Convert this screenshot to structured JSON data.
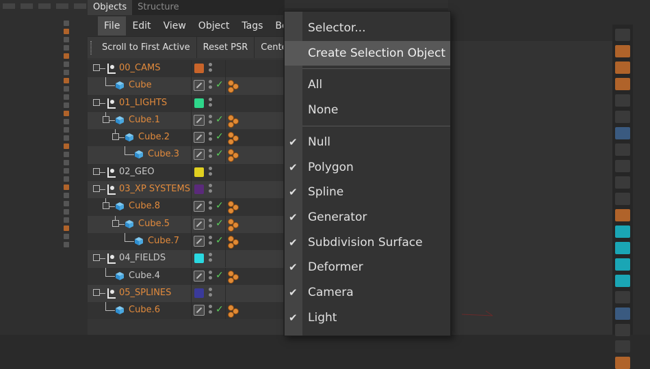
{
  "panel": {
    "tabs": [
      {
        "label": "Objects",
        "active": true
      },
      {
        "label": "Structure",
        "active": false
      }
    ],
    "menu": [
      {
        "label": "File",
        "active": true
      },
      {
        "label": "Edit",
        "active": false
      },
      {
        "label": "View",
        "active": false
      },
      {
        "label": "Object",
        "active": false
      },
      {
        "label": "Tags",
        "active": false
      },
      {
        "label": "Bo",
        "active": false
      }
    ],
    "toolbar": [
      "Scroll to First Active",
      "Reset PSR",
      "Center"
    ]
  },
  "objects": [
    {
      "name": "00_CAMS",
      "kind": "null",
      "depth": 0,
      "color": "#c8642a",
      "name_color": "orange",
      "checked": false,
      "tag": false
    },
    {
      "name": "Cube",
      "kind": "cube",
      "depth": 1,
      "name_color": "orange",
      "checked": true,
      "tag": true
    },
    {
      "name": "01_LIGHTS",
      "kind": "null",
      "depth": 0,
      "color": "#2ed68a",
      "name_color": "orange",
      "checked": false,
      "tag": false
    },
    {
      "name": "Cube.1",
      "kind": "cube",
      "depth": 1,
      "name_color": "orange",
      "checked": true,
      "tag": true
    },
    {
      "name": "Cube.2",
      "kind": "cube",
      "depth": 2,
      "name_color": "orange",
      "checked": true,
      "tag": true
    },
    {
      "name": "Cube.3",
      "kind": "cube",
      "depth": 3,
      "name_color": "orange",
      "checked": true,
      "tag": true
    },
    {
      "name": "02_GEO",
      "kind": "null",
      "depth": 0,
      "color": "#e0d020",
      "name_color": "gray",
      "checked": false,
      "tag": false
    },
    {
      "name": "03_XP SYSTEMS",
      "kind": "null",
      "depth": 0,
      "color": "#5a2a7a",
      "name_color": "orange",
      "checked": false,
      "tag": false
    },
    {
      "name": "Cube.8",
      "kind": "cube",
      "depth": 1,
      "name_color": "orange",
      "checked": true,
      "tag": true
    },
    {
      "name": "Cube.5",
      "kind": "cube",
      "depth": 2,
      "name_color": "orange",
      "checked": true,
      "tag": true
    },
    {
      "name": "Cube.7",
      "kind": "cube",
      "depth": 3,
      "name_color": "orange",
      "checked": true,
      "tag": true
    },
    {
      "name": "04_FIELDS",
      "kind": "null",
      "depth": 0,
      "color": "#2ad8e0",
      "name_color": "gray",
      "checked": false,
      "tag": false
    },
    {
      "name": "Cube.4",
      "kind": "cube",
      "depth": 1,
      "name_color": "gray",
      "checked": true,
      "tag": true
    },
    {
      "name": "05_SPLINES",
      "kind": "null",
      "depth": 0,
      "color": "#3a3a9a",
      "name_color": "orange",
      "checked": false,
      "tag": false
    },
    {
      "name": "Cube.6",
      "kind": "cube",
      "depth": 1,
      "name_color": "orange",
      "checked": true,
      "tag": true
    }
  ],
  "dropdown": {
    "groups": [
      [
        {
          "label": "Selector...",
          "checked": false,
          "highlight": false
        },
        {
          "label": "Create Selection Object",
          "checked": false,
          "highlight": true
        }
      ],
      [
        {
          "label": "All",
          "checked": false,
          "highlight": false
        },
        {
          "label": "None",
          "checked": false,
          "highlight": false
        }
      ],
      [
        {
          "label": "Null",
          "checked": true,
          "highlight": false
        },
        {
          "label": "Polygon",
          "checked": true,
          "highlight": false
        },
        {
          "label": "Spline",
          "checked": true,
          "highlight": false
        },
        {
          "label": "Generator",
          "checked": true,
          "highlight": false
        },
        {
          "label": "Subdivision Surface",
          "checked": true,
          "highlight": false
        },
        {
          "label": "Deformer",
          "checked": true,
          "highlight": false
        },
        {
          "label": "Camera",
          "checked": true,
          "highlight": false
        },
        {
          "label": "Light",
          "checked": true,
          "highlight": false
        }
      ]
    ]
  },
  "icons": {
    "menu": "hamburger-icon",
    "null": "null-object-icon",
    "cube": "cube-icon",
    "check": "check-icon",
    "tag": "tag-icon"
  },
  "colors": {
    "accent_orange": "#e18a3c",
    "check_green": "#5ad05a",
    "highlight": "#585858"
  }
}
